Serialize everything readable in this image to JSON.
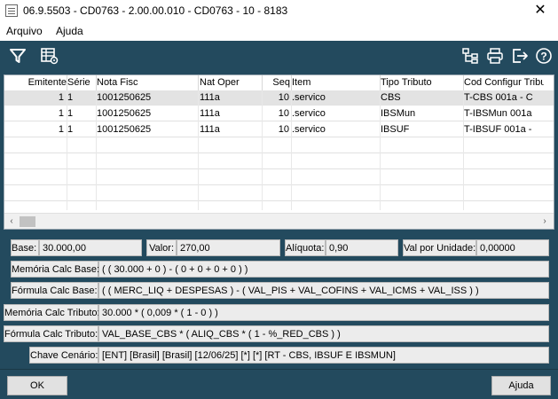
{
  "window": {
    "title": "06.9.5503 - CD0763 - 2.00.00.010 - CD0763 - 10 - 8183",
    "close_glyph": "✕"
  },
  "menu": {
    "items": [
      "Arquivo",
      "Ajuda"
    ]
  },
  "toolbar": {
    "left_icons": [
      "filter-icon",
      "table-settings-icon"
    ],
    "right_icons": [
      "hierarchy-icon",
      "print-icon",
      "exit-icon",
      "help-icon"
    ],
    "help_glyph": "?"
  },
  "grid": {
    "columns": [
      "Emitente",
      "Série",
      "Nota Fisc",
      "Nat Oper",
      "Seq",
      "Item",
      "Tipo Tributo",
      "Cod Configur Tribu"
    ],
    "rows": [
      [
        "1",
        "1",
        "1001250625",
        "111a",
        "10",
        ".servico",
        "CBS",
        "T-CBS 001a - C"
      ],
      [
        "1",
        "1",
        "1001250625",
        "111a",
        "10",
        ".servico",
        "IBSMun",
        "T-IBSMun 001a"
      ],
      [
        "1",
        "1",
        "1001250625",
        "111a",
        "10",
        ".servico",
        "IBSUF",
        "T-IBSUF 001a -"
      ]
    ],
    "scroll_left": "‹",
    "scroll_right": "›"
  },
  "details": {
    "base_label": "Base:",
    "base_value": "30.000,00",
    "valor_label": "Valor:",
    "valor_value": "270,00",
    "aliquota_label": "Alíquota:",
    "aliquota_value": "0,90",
    "val_unidade_label": "Val por Unidade:",
    "val_unidade_value": "0,00000",
    "mem_base_label": "Memória Calc Base:",
    "mem_base_value": "( ( 30.000 + 0 ) - ( 0 + 0 + 0 + 0 ) )",
    "form_base_label": "Fórmula Calc Base:",
    "form_base_value": "( ( MERC_LIQ + DESPESAS ) - ( VAL_PIS + VAL_COFINS + VAL_ICMS + VAL_ISS ) )",
    "mem_trib_label": "Memória Calc Tributo:",
    "mem_trib_value": "30.000 * ( 0,009 * ( 1 - 0 ) )",
    "form_trib_label": "Fórmula Calc Tributo:",
    "form_trib_value": "VAL_BASE_CBS * ( ALIQ_CBS * ( 1 - %_RED_CBS ) )",
    "chave_label": "Chave Cenário:",
    "chave_value": "[ENT] [Brasil] [Brasil] [12/06/25] [*] [*] [RT - CBS, IBSUF E IBSMUN]"
  },
  "buttons": {
    "ok": "OK",
    "help": "Ajuda"
  }
}
